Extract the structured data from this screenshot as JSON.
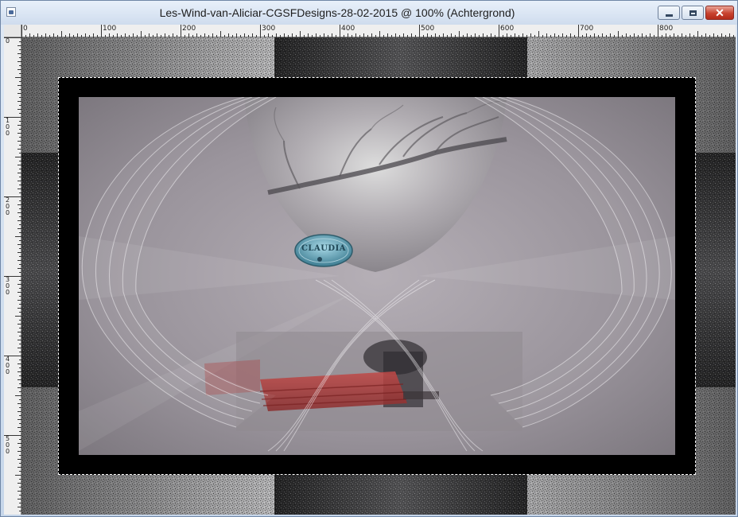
{
  "window": {
    "title": "Les-Wind-van-Aliciar-CGSFDesigns-28-02-2015 @ 100% (Achtergrond)",
    "icon": "image-document-icon",
    "controls": {
      "minimize": "minimize-icon",
      "maximize": "maximize-icon",
      "close": "close-icon"
    }
  },
  "ruler": {
    "horizontal_labels": [
      "0",
      "100",
      "200",
      "300",
      "400",
      "500",
      "600",
      "700",
      "800"
    ],
    "vertical_labels": [
      "0",
      "100",
      "200",
      "300",
      "400",
      "500"
    ]
  },
  "canvas": {
    "watermark_text": "CLAUDIA",
    "colors": {
      "frame": "#000000",
      "mist": "#9a949c",
      "bench": "#b0393a",
      "selection": "#ffffff"
    }
  }
}
